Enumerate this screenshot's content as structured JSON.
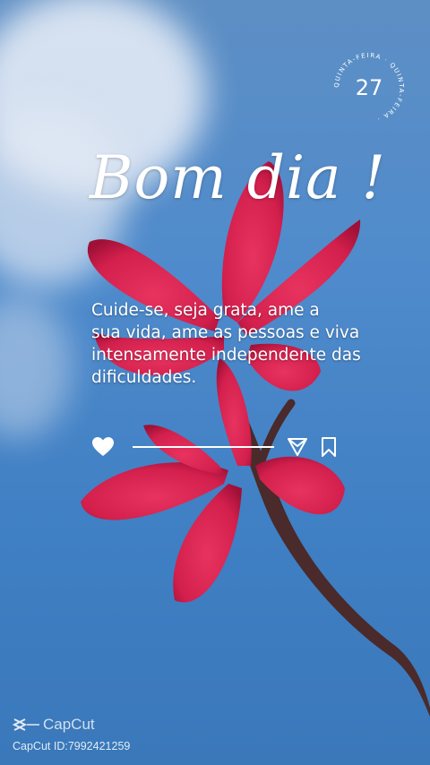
{
  "date_badge": {
    "day": "27",
    "weekday_ring_text": "QUINTA-FEIRA · QUINTA-FEIRA · "
  },
  "greeting": {
    "title": "Bom dia !"
  },
  "quote": {
    "lines": [
      "Cuide-se, seja grata, ame a",
      "sua vida, ame as pessoas e viva",
      "intensamente independente das",
      "dificuldades."
    ]
  },
  "actions": {
    "like_icon": "heart-icon",
    "share_icon": "send-icon",
    "save_icon": "bookmark-icon"
  },
  "watermark": {
    "brand": "CapCut",
    "id_text": "CapCut ID:7992421259"
  },
  "colors": {
    "sky": "#4f8bcc",
    "flower": "#d21f4c",
    "text": "#ffffff"
  }
}
